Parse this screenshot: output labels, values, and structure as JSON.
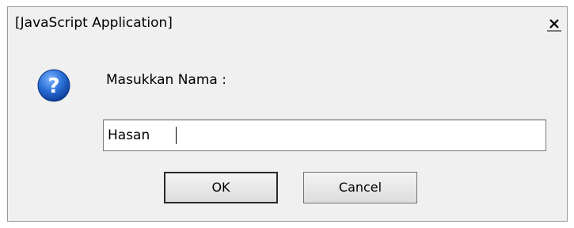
{
  "window": {
    "title": "[JavaScript Application]",
    "close_icon": "close-x-icon"
  },
  "dialog": {
    "icon": "question-icon",
    "prompt": "Masukkan Nama :",
    "input_value": "Hasan",
    "ok_label": "OK",
    "cancel_label": "Cancel"
  },
  "colors": {
    "background": "#f0f0f0",
    "icon_blue": "#2a6fd6",
    "input_bg": "#ffffff"
  }
}
